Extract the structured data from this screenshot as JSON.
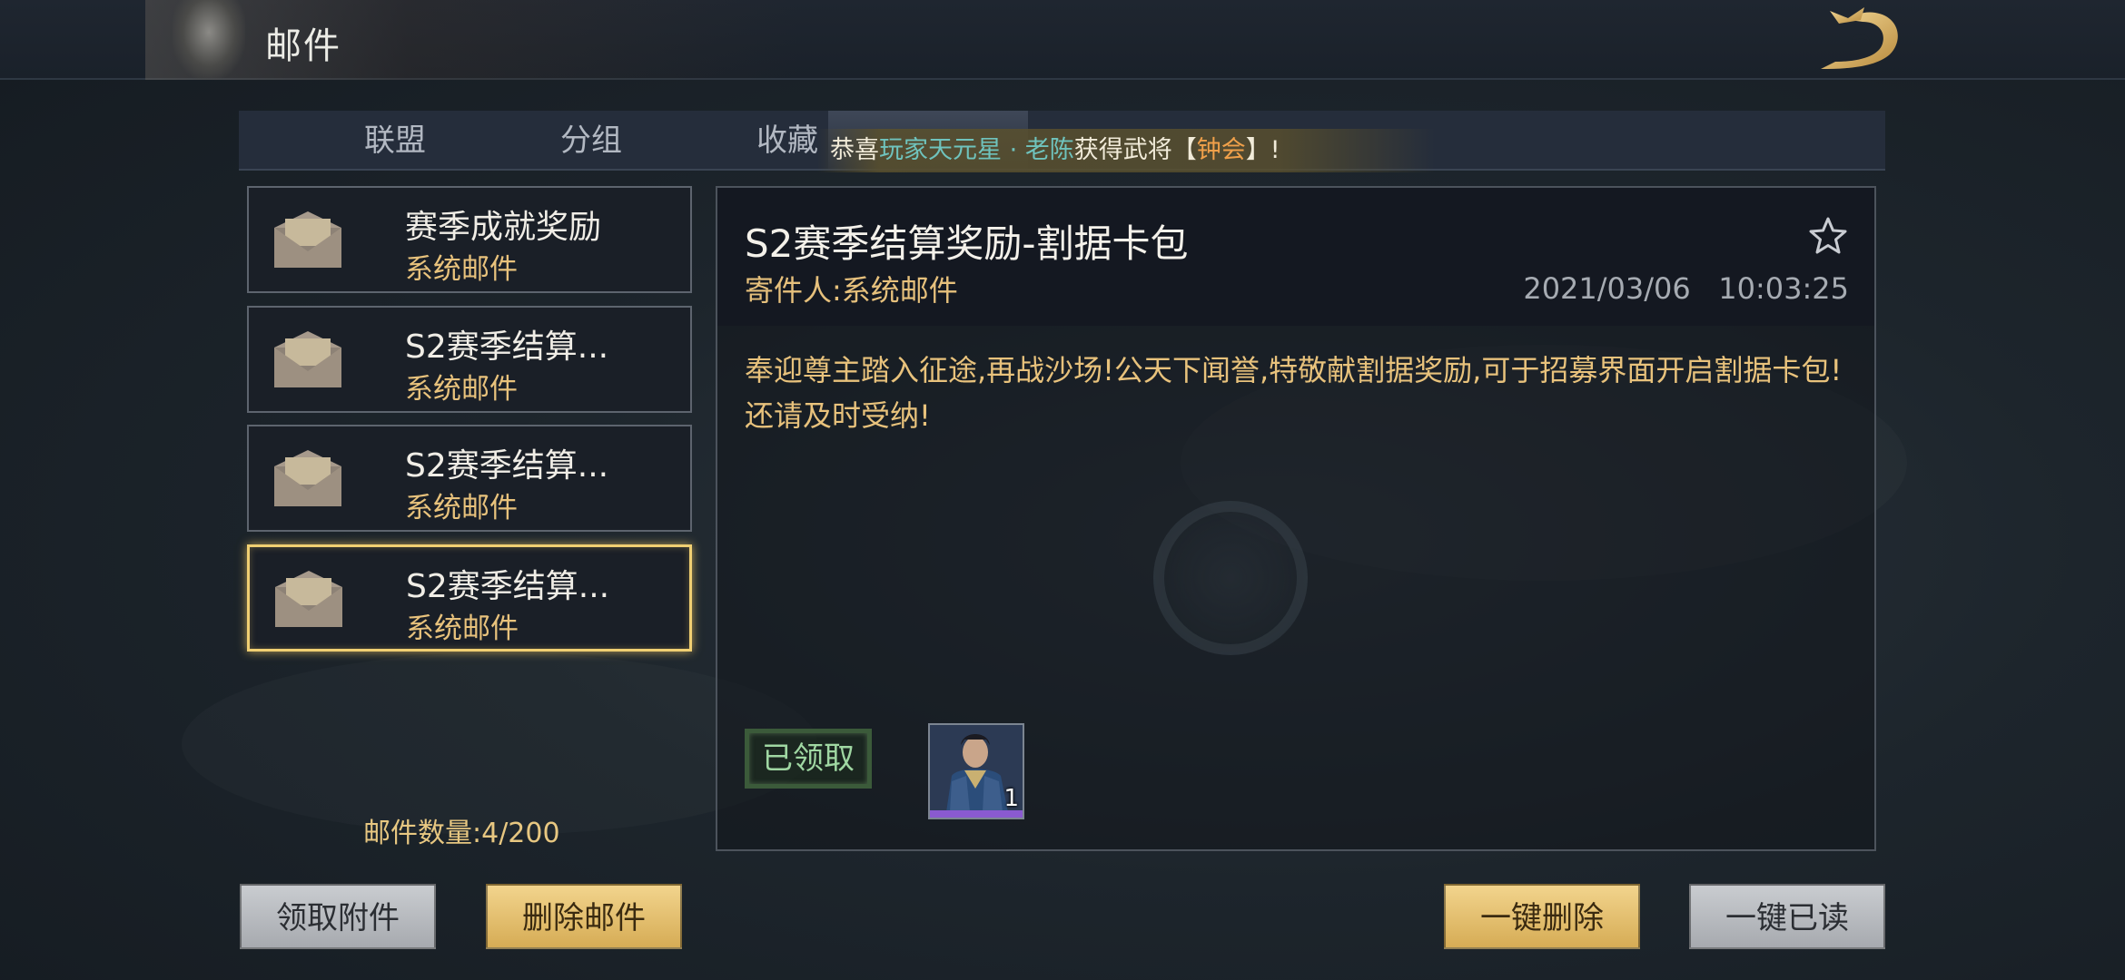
{
  "header": {
    "title": "邮件"
  },
  "tabs": [
    {
      "label": "联盟"
    },
    {
      "label": "分组"
    },
    {
      "label": "收藏"
    }
  ],
  "marquee": {
    "prefix": "恭喜",
    "player": "玩家天元星 · 老陈",
    "middle": "获得武将【",
    "general": "钟会",
    "suffix": "】!"
  },
  "mail_list": [
    {
      "title": "赛季成就奖励",
      "sender": "系统邮件",
      "selected": false
    },
    {
      "title": "S2赛季结算...",
      "sender": "系统邮件",
      "selected": false
    },
    {
      "title": "S2赛季结算...",
      "sender": "系统邮件",
      "selected": false
    },
    {
      "title": "S2赛季结算...",
      "sender": "系统邮件",
      "selected": true
    }
  ],
  "mail_count": "邮件数量:4/200",
  "detail": {
    "title": "S2赛季结算奖励-割据卡包",
    "sender": "寄件人:系统邮件",
    "date": "2021/03/06   10:03:25",
    "body": "奉迎尊主踏入征途,再战沙场!公天下闻誉,特敬献割据奖励,可于招募界面开启割据卡包!还请及时受纳!",
    "status": "已领取",
    "reward": {
      "count": "1",
      "icon": "general-portrait"
    }
  },
  "buttons": {
    "claim_attachments": "领取附件",
    "delete_mail": "删除邮件",
    "delete_all": "一键删除",
    "read_all": "一键已读"
  },
  "colors": {
    "accent_gold": "#e8c27c",
    "selected_border": "#f0cf72",
    "teal_name": "#6fc3bd"
  }
}
